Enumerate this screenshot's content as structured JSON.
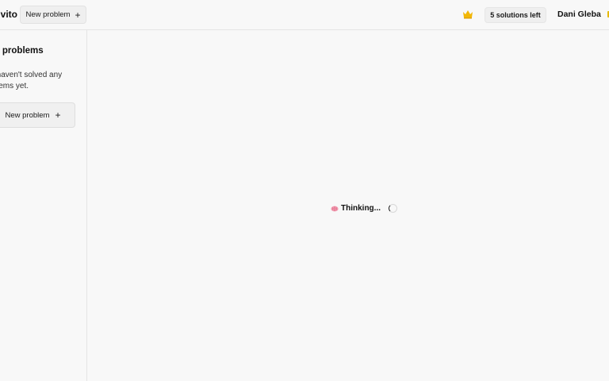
{
  "header": {
    "brand": "Solvito",
    "new_problem_label": "New problem",
    "plus_symbol": "+",
    "solutions_left": "5 solutions left",
    "user_name": "Dani Gleba",
    "crown_icon": "crown-icon",
    "crown_color": "#f2b705"
  },
  "sidebar": {
    "title": "Solved problems",
    "empty_message": "You haven't solved any problems yet.",
    "new_problem_label": "New problem",
    "plus_symbol": "+"
  },
  "main": {
    "status_text": "Thinking...",
    "status_icon": "brain-icon",
    "spinner": "loading-spinner"
  }
}
